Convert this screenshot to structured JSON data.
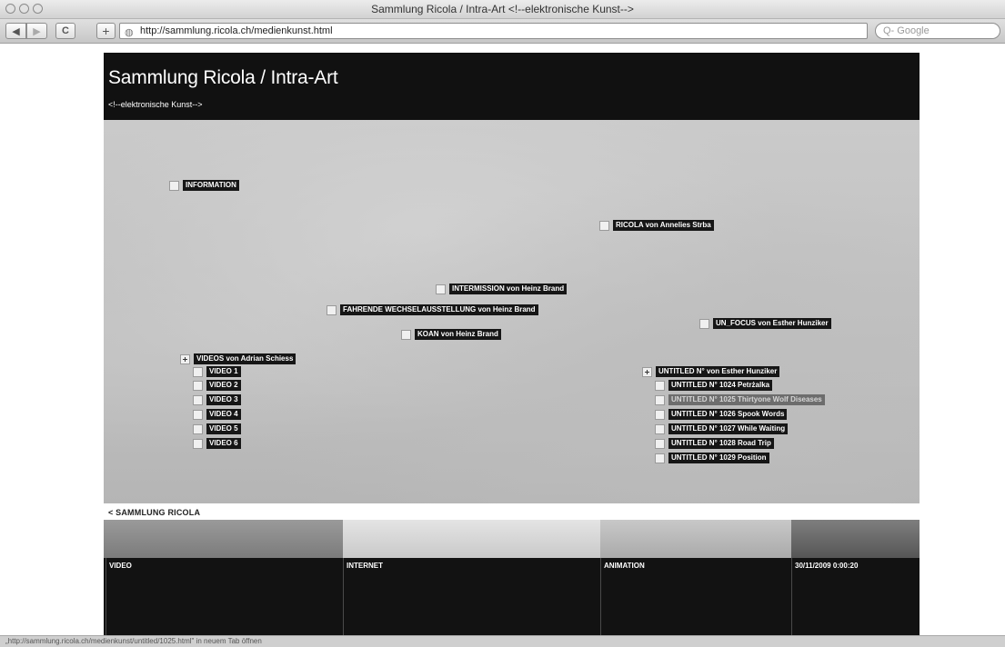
{
  "window": {
    "title": "Sammlung Ricola / Intra-Art <!--elektronische Kunst-->"
  },
  "toolbar": {
    "back_label": "◀",
    "forward_label": "▶",
    "reload_label": "C",
    "add_label": "+",
    "url": "http://sammlung.ricola.ch/medienkunst.html",
    "search_placeholder": "Q- Google"
  },
  "header": {
    "title": "Sammlung Ricola / Intra-Art",
    "subtitle": "<!--elektronische Kunst-->"
  },
  "nodes": {
    "information": "INFORMATION",
    "ricola": "RICOLA von Annelies Strba",
    "intermission": "INTERMISSION von Heinz Brand",
    "fahrende": "FAHRENDE WECHSELAUSSTELLUNG von Heinz Brand",
    "koan": "KOAN von Heinz Brand",
    "unfocus": "UN_FOCUS von Esther Hunziker",
    "videos": "VIDEOS von Adrian Schiess",
    "video_items": [
      "VIDEO 1",
      "VIDEO 2",
      "VIDEO 3",
      "VIDEO 4",
      "VIDEO 5",
      "VIDEO 6"
    ],
    "untitled": "UNTITLED N° von Esther Hunziker",
    "untitled_items": [
      "UNTITLED N° 1024 Petrżalka",
      "UNTITLED N° 1025 Thirtyone Wolf Diseases",
      "UNTITLED N° 1026 Spook Words",
      "UNTITLED N° 1027 While Waiting",
      "UNTITLED N° 1028 Road Trip",
      "UNTITLED N° 1029 Position"
    ]
  },
  "back_link": "< SAMMLUNG RICOLA",
  "footer": {
    "col1": "VIDEO",
    "col2": "INTERNET",
    "col3": "ANIMATION",
    "timestamp": "30/11/2009 0:00:20"
  },
  "status_bar": "„http://sammlung.ricola.ch/medienkunst/untitled/1025.html\" in neuem Tab öffnen"
}
